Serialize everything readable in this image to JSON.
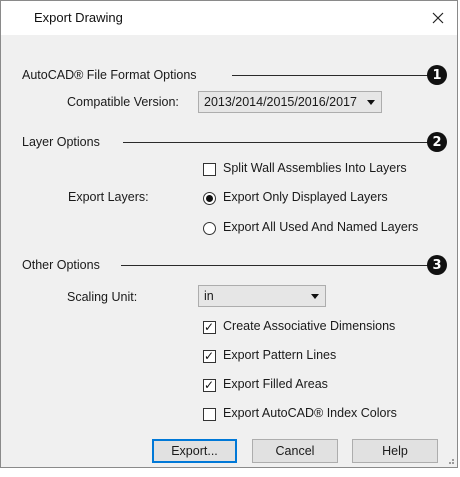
{
  "window": {
    "title": "Export Drawing"
  },
  "sections": {
    "autocad": {
      "label": "AutoCAD® File Format Options",
      "callout": "1",
      "compatible_version_label": "Compatible Version:",
      "compatible_version_value": "2013/2014/2015/2016/2017"
    },
    "layers": {
      "label": "Layer Options",
      "callout": "2",
      "split_wall_label": "Split Wall Assemblies Into Layers",
      "split_wall_checked": false,
      "export_layers_label": "Export Layers:",
      "radio_displayed_label": "Export Only Displayed Layers",
      "radio_all_label": "Export All Used And Named Layers",
      "selected": "displayed"
    },
    "other": {
      "label": "Other Options",
      "callout": "3",
      "scaling_unit_label": "Scaling Unit:",
      "scaling_unit_value": "in",
      "options": [
        {
          "label": "Create Associative Dimensions",
          "checked": true
        },
        {
          "label": "Export Pattern Lines",
          "checked": true
        },
        {
          "label": "Export Filled Areas",
          "checked": true
        },
        {
          "label": "Export AutoCAD® Index Colors",
          "checked": false
        }
      ]
    }
  },
  "buttons": {
    "export": "Export...",
    "cancel": "Cancel",
    "help": "Help"
  }
}
